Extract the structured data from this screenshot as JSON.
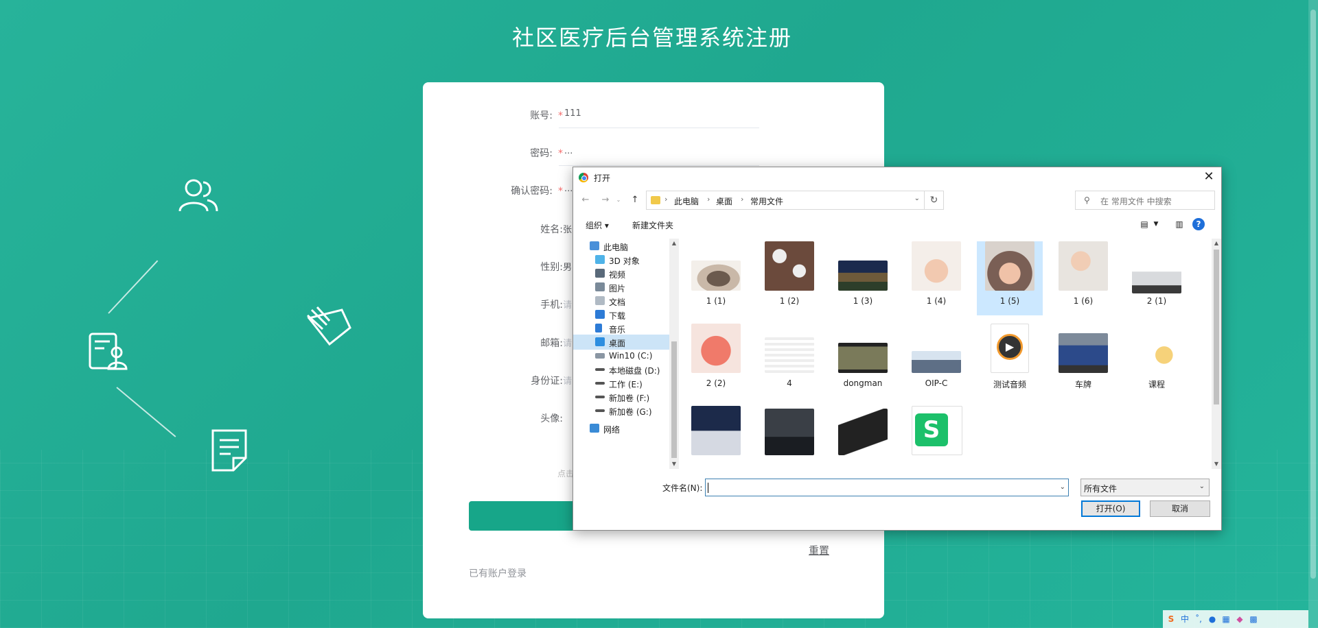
{
  "page": {
    "title": "社区医疗后台管理系统注册",
    "reset_label": "重置",
    "login_link": "已有账户登录",
    "click_hint": "点击"
  },
  "form": {
    "account": {
      "label": "账号:",
      "value": "111"
    },
    "password": {
      "label": "密码:",
      "value": "..."
    },
    "confirm": {
      "label": "确认密码:",
      "value": "..."
    },
    "name": {
      "label": "姓名:",
      "value": "张"
    },
    "gender": {
      "label": "性别:",
      "value": "男"
    },
    "phone": {
      "label": "手机:",
      "value": "请"
    },
    "email": {
      "label": "邮箱:",
      "value": "请"
    },
    "idcard": {
      "label": "身份证:",
      "value": "请"
    },
    "avatar": {
      "label": "头像:"
    },
    "required_mark": "*"
  },
  "dialog": {
    "title": "打开",
    "close": "✕",
    "breadcrumb": [
      "此电脑",
      "桌面",
      "常用文件"
    ],
    "search_placeholder": "在 常用文件 中搜索",
    "organize": "组织 ▾",
    "new_folder": "新建文件夹",
    "nav_items": [
      {
        "label": "此电脑"
      },
      {
        "label": "3D 对象"
      },
      {
        "label": "视频"
      },
      {
        "label": "图片"
      },
      {
        "label": "文档"
      },
      {
        "label": "下载"
      },
      {
        "label": "音乐"
      },
      {
        "label": "桌面"
      },
      {
        "label": "Win10 (C:)"
      },
      {
        "label": "本地磁盘 (D:)"
      },
      {
        "label": "工作 (E:)"
      },
      {
        "label": "新加卷 (F:)"
      },
      {
        "label": "新加卷 (G:)"
      },
      {
        "label": "网络"
      }
    ],
    "files": [
      {
        "name": "1 (1)"
      },
      {
        "name": "1 (2)"
      },
      {
        "name": "1 (3)"
      },
      {
        "name": "1 (4)"
      },
      {
        "name": "1 (5)"
      },
      {
        "name": "1 (6)"
      },
      {
        "name": "2 (1)"
      },
      {
        "name": "2 (2)"
      },
      {
        "name": "4"
      },
      {
        "name": "dongman"
      },
      {
        "name": "OIP-C"
      },
      {
        "name": "测试音频"
      },
      {
        "name": "车牌"
      },
      {
        "name": "课程"
      }
    ],
    "filename_label": "文件名(N):",
    "filename_value": "",
    "filetype": "所有文件",
    "open_button": "打开(O)",
    "cancel_button": "取消"
  },
  "colors": {
    "brand": "#17a689",
    "selection": "#cce8ff",
    "accent_blue": "#0078d7"
  }
}
